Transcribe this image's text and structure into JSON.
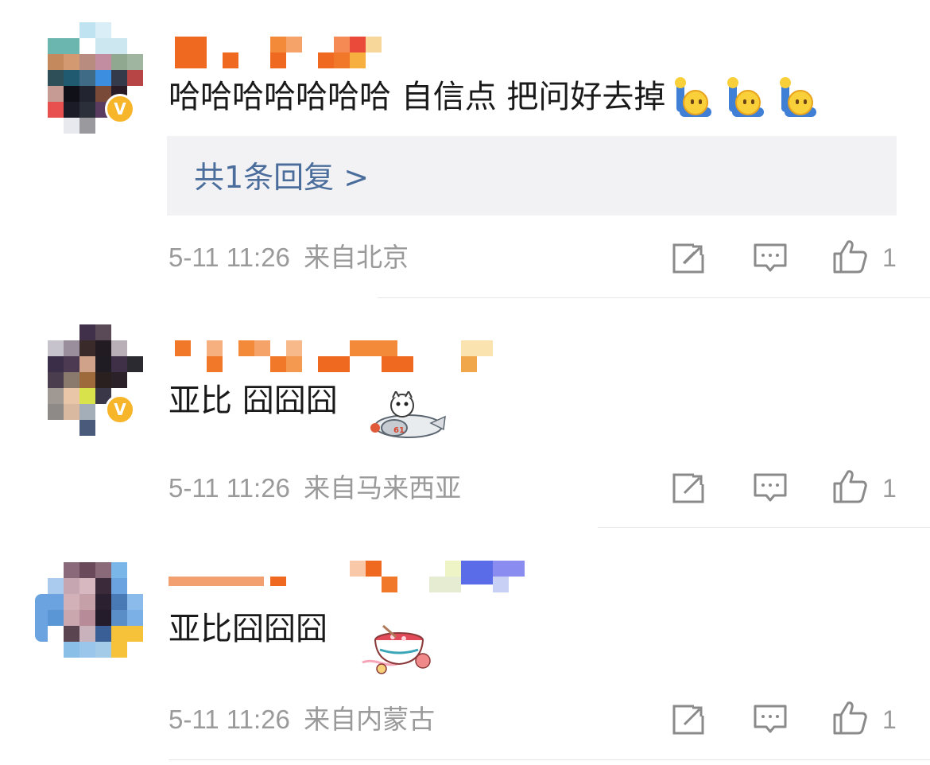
{
  "comments": [
    {
      "text": "哈哈哈哈哈哈哈 自信点 把问好去掉",
      "emojis": [
        "raising-hand-emoji",
        "raising-hand-emoji",
        "raising-hand-emoji"
      ],
      "reply_link": "共1条回复 >",
      "time": "5-11 11:26",
      "location": "来自北京",
      "likes": "1",
      "verified": true
    },
    {
      "text": "亚比 囧囧囧",
      "sticker": "airplane-sticker",
      "time": "5-11 11:26",
      "location": "来自马来西亚",
      "likes": "1",
      "verified": true
    },
    {
      "text": "亚比囧囧囧",
      "sticker": "bowl-sticker",
      "time": "5-11 11:26",
      "location": "来自内蒙古",
      "likes": "1",
      "verified": false
    }
  ],
  "colors": {
    "link": "#4a6d9c",
    "meta": "#9a9a9a",
    "badge": "#f7b52a",
    "name_mosaic": "#f07a2a"
  },
  "icons": [
    "share-icon",
    "comment-icon",
    "like-icon"
  ]
}
